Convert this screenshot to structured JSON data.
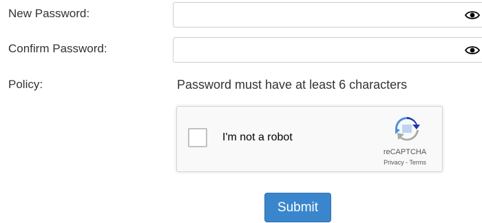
{
  "form": {
    "new_password_label": "New Password:",
    "new_password_value": "",
    "confirm_password_label": "Confirm Password:",
    "confirm_password_value": "",
    "policy_label": "Policy:",
    "policy_text": "Password must have at least 6 characters",
    "submit_label": "Submit"
  },
  "recaptcha": {
    "checkbox_label": "I'm not a robot",
    "brand": "reCAPTCHA",
    "links": "Privacy - Terms",
    "checked": false
  },
  "icons": {
    "toggle_visibility": "eye-icon",
    "recaptcha_logo": "recaptcha-logo-icon"
  },
  "colors": {
    "submit_bg": "#3a86cc",
    "recaptcha_blue": "#1c3aa9",
    "recaptcha_lightblue": "#4a90e2",
    "recaptcha_gray": "#ababab"
  }
}
